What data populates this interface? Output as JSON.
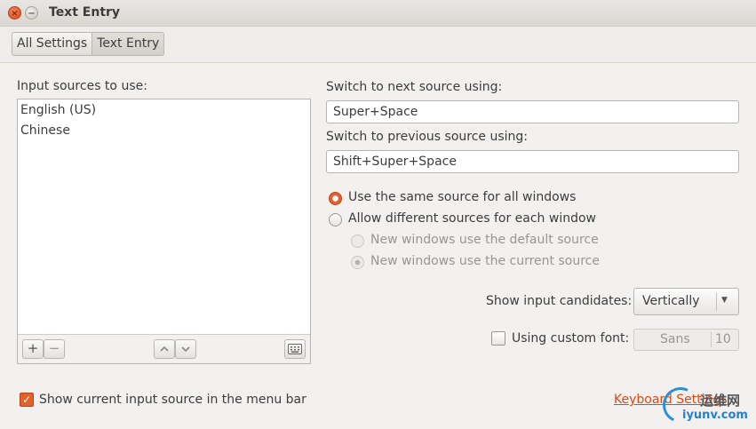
{
  "window": {
    "title": "Text Entry"
  },
  "breadcrumb": {
    "items": [
      "All Settings",
      "Text Entry"
    ]
  },
  "input_sources": {
    "label": "Input sources to use:",
    "items": [
      "English (US)",
      "Chinese"
    ]
  },
  "list_toolbar": {
    "add": "+",
    "remove": "−",
    "up": "^",
    "down": "v"
  },
  "shortcuts": {
    "next_label": "Switch to next source using:",
    "next_value": "Super+Space",
    "prev_label": "Switch to previous source using:",
    "prev_value": "Shift+Super+Space"
  },
  "source_options": {
    "same": "Use the same source for all windows",
    "different": "Allow different sources for each window",
    "default_source": "New windows use the default source",
    "current_source": "New windows use the current source"
  },
  "candidates": {
    "label": "Show input candidates:",
    "value": "Vertically"
  },
  "custom_font": {
    "label": "Using custom font:",
    "font": "Sans",
    "size": "10"
  },
  "menu_bar": {
    "label": "Show current input source in the menu bar"
  },
  "keyboard_link": "Keyboard Settings",
  "watermark": {
    "top": "运维网",
    "bottom": "iyunv.com"
  },
  "colors": {
    "accent": "#dd4814",
    "checked": "#e0622e"
  }
}
